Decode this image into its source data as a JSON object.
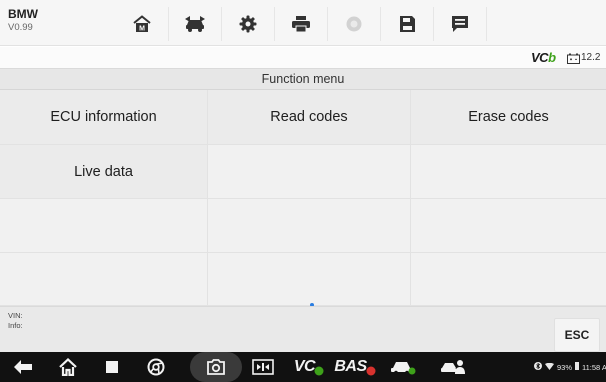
{
  "header": {
    "brand": "BMW",
    "version": "V0.99",
    "toolbar": [
      {
        "name": "home-icon"
      },
      {
        "name": "vehicle-swap-icon"
      },
      {
        "name": "settings-icon"
      },
      {
        "name": "print-icon"
      },
      {
        "name": "help-icon"
      },
      {
        "name": "save-icon"
      },
      {
        "name": "message-icon"
      }
    ]
  },
  "status": {
    "vci_prefix": "VC",
    "vci_suffix": "b",
    "voltage": "12.2"
  },
  "menu": {
    "title": "Function menu",
    "items": [
      "ECU information",
      "Read codes",
      "Erase codes",
      "Live data",
      "",
      "",
      "",
      "",
      "",
      "",
      "",
      ""
    ]
  },
  "footer": {
    "vin_label": "VIN:",
    "info_label": "Info:",
    "esc_label": "ESC"
  },
  "navbar": {
    "vcds_label": "VC",
    "bas_label": "BAS",
    "battery_percent": "93%",
    "time": "11:58 A"
  },
  "colors": {
    "accent_green": "#3ea11a",
    "toolbar_icon": "#333333",
    "nav_bg": "#111111",
    "scroll_dot": "#2a7de1"
  }
}
